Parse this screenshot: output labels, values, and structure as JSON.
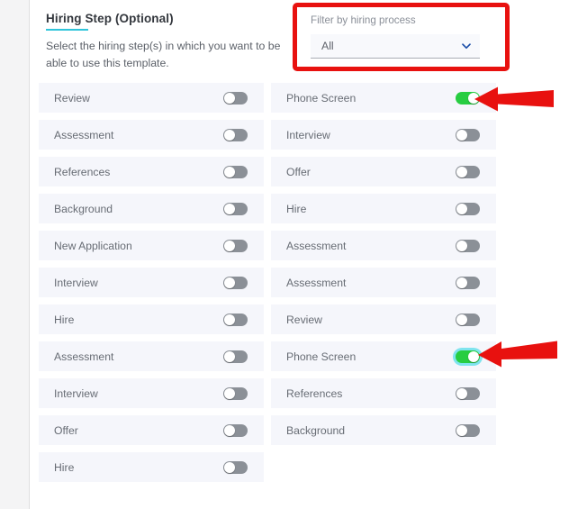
{
  "panel": {
    "title": "Hiring Step (Optional)",
    "description": "Select the hiring step(s) in which you want to be able to use this template.",
    "accent_color": "#2ec4da"
  },
  "filter": {
    "label": "Filter by hiring process",
    "value": "All",
    "chevron_icon": "chevron-down-icon",
    "highlight_color": "#e8110f"
  },
  "toggle_colors": {
    "on": "#27cd41",
    "off": "#8b9097",
    "focus_ring": "#7fe4ee"
  },
  "steps": {
    "left_column": [
      {
        "label": "Review",
        "enabled": false,
        "focused": false
      },
      {
        "label": "Assessment",
        "enabled": false,
        "focused": false
      },
      {
        "label": "References",
        "enabled": false,
        "focused": false
      },
      {
        "label": "Background",
        "enabled": false,
        "focused": false
      },
      {
        "label": "New Application",
        "enabled": false,
        "focused": false
      },
      {
        "label": "Interview",
        "enabled": false,
        "focused": false
      },
      {
        "label": "Hire",
        "enabled": false,
        "focused": false
      },
      {
        "label": "Assessment",
        "enabled": false,
        "focused": false
      },
      {
        "label": "Interview",
        "enabled": false,
        "focused": false
      },
      {
        "label": "Offer",
        "enabled": false,
        "focused": false
      },
      {
        "label": "Hire",
        "enabled": false,
        "focused": false
      }
    ],
    "right_column": [
      {
        "label": "Phone Screen",
        "enabled": true,
        "focused": false
      },
      {
        "label": "Interview",
        "enabled": false,
        "focused": false
      },
      {
        "label": "Offer",
        "enabled": false,
        "focused": false
      },
      {
        "label": "Hire",
        "enabled": false,
        "focused": false
      },
      {
        "label": "Assessment",
        "enabled": false,
        "focused": false
      },
      {
        "label": "Assessment",
        "enabled": false,
        "focused": false
      },
      {
        "label": "Review",
        "enabled": false,
        "focused": false
      },
      {
        "label": "Phone Screen",
        "enabled": true,
        "focused": true
      },
      {
        "label": "References",
        "enabled": false,
        "focused": false
      },
      {
        "label": "Background",
        "enabled": false,
        "focused": false
      }
    ]
  },
  "annotations": {
    "arrow_color": "#e8110f",
    "arrows": [
      {
        "name": "arrow-pointer-phone-screen-top",
        "points_to": "Phone Screen"
      },
      {
        "name": "arrow-pointer-phone-screen-bottom",
        "points_to": "Phone Screen"
      }
    ]
  }
}
